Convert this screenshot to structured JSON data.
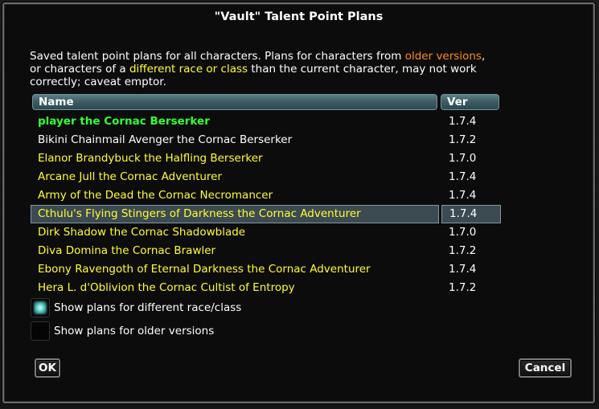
{
  "dialog": {
    "title": "\"Vault\" Talent Point Plans",
    "description": {
      "part1": "Saved talent point plans for all characters.  Plans for characters from ",
      "older_versions": "older versions",
      "part2": ",",
      "part3": "or characters of a ",
      "different_race_or_class": "different race or class",
      "part4": " than the current character, may not work",
      "part5": "correctly; caveat emptor."
    },
    "columns": {
      "name": "Name",
      "ver": "Ver"
    },
    "rows": [
      {
        "name": "player the Cornac Berserker",
        "ver": "1.7.4",
        "color": "#33ff33"
      },
      {
        "name": "Bikini Chainmail Avenger the Cornac Berserker",
        "ver": "1.7.2",
        "color": "#ffffff"
      },
      {
        "name": "Elanor Brandybuck the Halfling Berserker",
        "ver": "1.7.0",
        "color": "#ffff33"
      },
      {
        "name": "Arcane Jull the Cornac Adventurer",
        "ver": "1.7.4",
        "color": "#ffff33"
      },
      {
        "name": "Army of the Dead the Cornac Necromancer",
        "ver": "1.7.4",
        "color": "#ffff33"
      },
      {
        "name": "Cthulu's Flying Stingers of Darkness the Cornac Adventurer",
        "ver": "1.7.4",
        "color": "#ffff33",
        "selected": true
      },
      {
        "name": "Dirk Shadow the Cornac Shadowblade",
        "ver": "1.7.0",
        "color": "#ffff33"
      },
      {
        "name": "Diva Domina the Cornac Brawler",
        "ver": "1.7.2",
        "color": "#ffff33"
      },
      {
        "name": "Ebony Ravengoth of Eternal Darkness the Cornac Adventurer",
        "ver": "1.7.4",
        "color": "#ffff33"
      },
      {
        "name": "Hera L. d'Oblivion the Cornac Cultist of Entropy",
        "ver": "1.7.2",
        "color": "#ffff33"
      }
    ],
    "options": {
      "different_race_class": {
        "label": "Show plans for different race/class",
        "checked": true
      },
      "older_versions": {
        "label": "Show plans for older versions",
        "checked": false
      }
    },
    "buttons": {
      "ok": "OK",
      "cancel": "Cancel"
    }
  }
}
